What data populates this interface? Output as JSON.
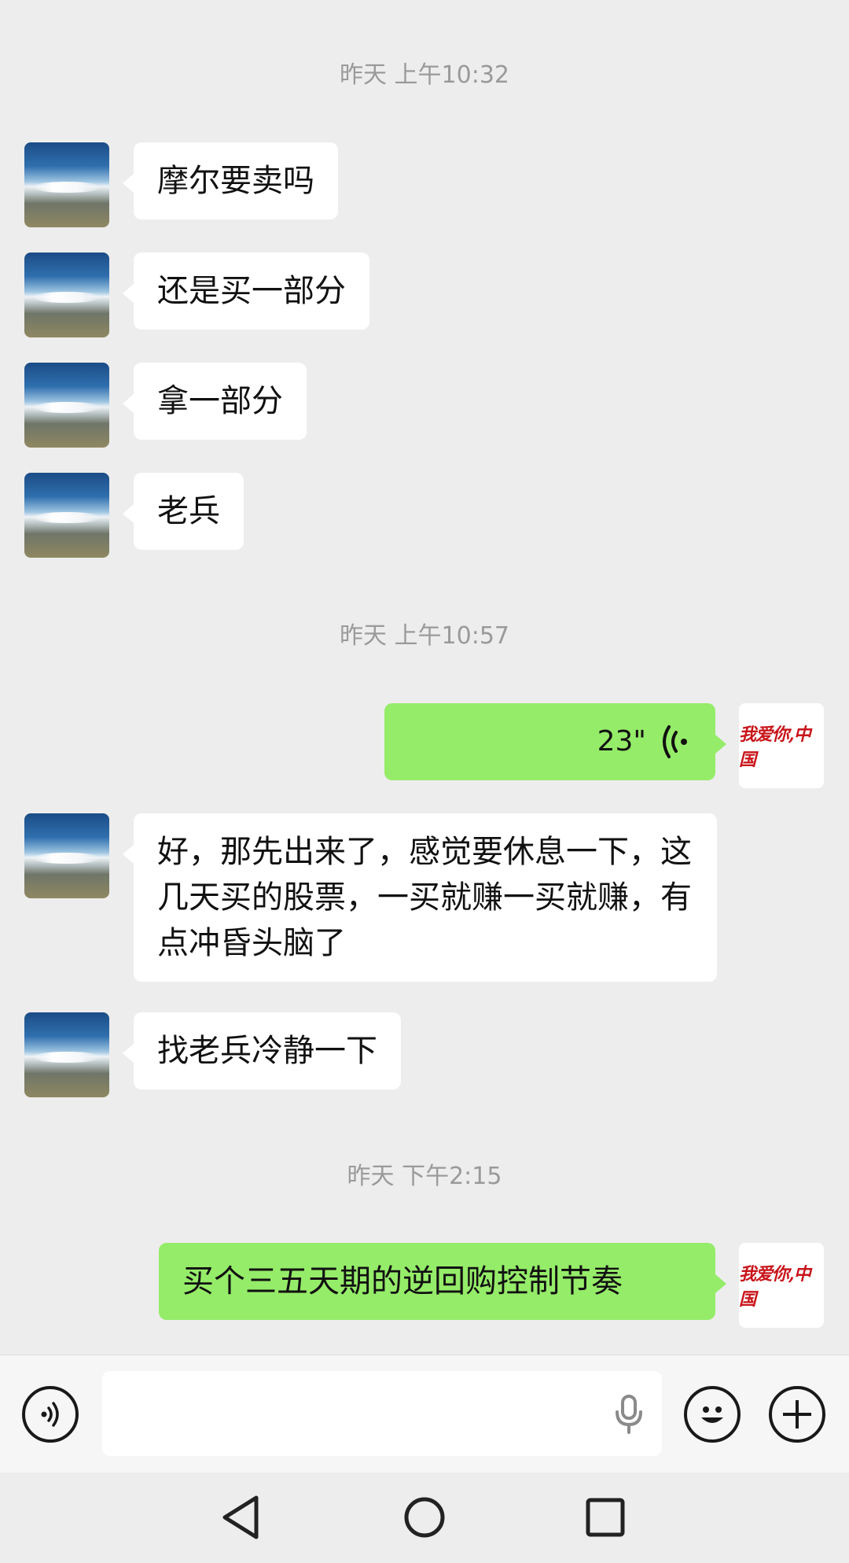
{
  "timestamps": [
    "昨天 上午10:32",
    "昨天 上午10:57",
    "昨天 下午2:15"
  ],
  "messages": [
    {
      "side": "left",
      "text": "摩尔要卖吗"
    },
    {
      "side": "left",
      "text": "还是买一部分"
    },
    {
      "side": "left",
      "text": "拿一部分"
    },
    {
      "side": "left",
      "text": "老兵"
    },
    {
      "side": "right",
      "type": "voice",
      "duration": "23\""
    },
    {
      "side": "left",
      "text": "好，那先出来了，感觉要休息一下，这几天买的股票，一买就赚一买就赚，有点冲昏头脑了"
    },
    {
      "side": "left",
      "text": "找老兵冷静一下"
    },
    {
      "side": "right",
      "text": "买个三五天期的逆回购控制节奏"
    }
  ],
  "self_avatar_text": "我爱你,中国",
  "input": {
    "value": ""
  },
  "icons": {
    "voice_toggle": "voice-icon",
    "mic": "microphone-icon",
    "emoji": "emoji-icon",
    "more": "plus-icon",
    "nav_back": "back-triangle-icon",
    "nav_home": "home-circle-icon",
    "nav_recent": "recent-square-icon"
  },
  "colors": {
    "background": "#ededed",
    "self_bubble": "#95ec69",
    "other_bubble": "#ffffff",
    "logo_red": "#c8141a"
  }
}
